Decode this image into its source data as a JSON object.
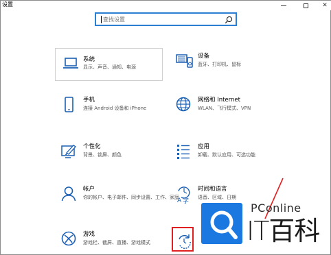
{
  "window": {
    "title": "设置",
    "minimize_label": "",
    "maximize_label": "",
    "close_label": "✕"
  },
  "search": {
    "placeholder": "查找设置"
  },
  "tiles": [
    {
      "name": "系统",
      "desc": "显示、声音、通知、电源",
      "icon": "laptop-icon"
    },
    {
      "name": "设备",
      "desc": "蓝牙、打印机、鼠标",
      "icon": "devices-icon"
    },
    {
      "name": "手机",
      "desc": "连接 Android 设备和 iPhone",
      "icon": "phone-icon"
    },
    {
      "name": "网络和 Internet",
      "desc": "WLAN、飞行模式、VPN",
      "icon": "globe-icon"
    },
    {
      "name": "个性化",
      "desc": "背景、锁屏、颜色",
      "icon": "paint-icon"
    },
    {
      "name": "应用",
      "desc": "卸载、默认应用、可选功能",
      "icon": "apps-list-icon"
    },
    {
      "name": "帐户",
      "desc": "你的帐户、电子邮件、同步设置、工作、家庭",
      "icon": "person-icon"
    },
    {
      "name": "时间和语言",
      "desc": "语音、区域、日期",
      "icon": "time-language-icon"
    },
    {
      "name": "游戏",
      "desc": "游戏栏、截屏、直播、游戏模式",
      "icon": "xbox-icon"
    },
    {
      "name": "",
      "desc": "",
      "icon": "update-icon"
    }
  ],
  "watermark": {
    "small": "PConline",
    "big": "IT百科",
    "color": "#1a78e0"
  },
  "accent": "#2a7fd3",
  "highlight_color": "#e02020"
}
